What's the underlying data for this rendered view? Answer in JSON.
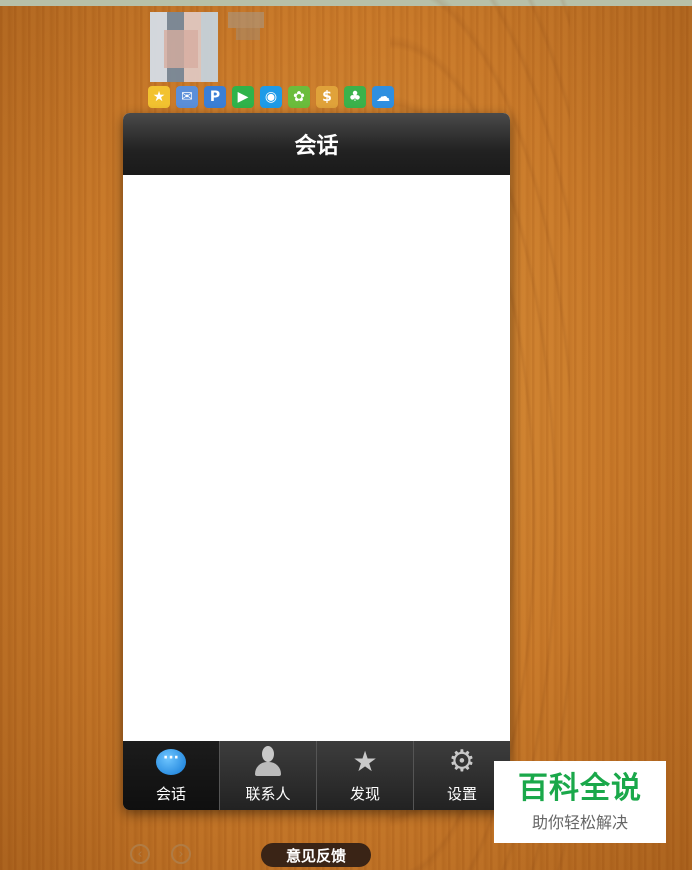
{
  "window": {
    "title": "会话"
  },
  "profile": {
    "icons": [
      {
        "name": "qzone-star-icon",
        "glyph": "★",
        "color": "#f2c230"
      },
      {
        "name": "mail-icon",
        "glyph": "✉",
        "color": "#5b8fd9"
      },
      {
        "name": "search-icon",
        "glyph": "P",
        "color": "#3a7fd6"
      },
      {
        "name": "video-play-icon",
        "glyph": "▶",
        "color": "#2fb34a"
      },
      {
        "name": "browser-icon",
        "glyph": "◉",
        "color": "#1e9be8"
      },
      {
        "name": "pet-icon",
        "glyph": "✿",
        "color": "#6bbd3c"
      },
      {
        "name": "wallet-icon",
        "glyph": "$",
        "color": "#e0a23a"
      },
      {
        "name": "clover-icon",
        "glyph": "♣",
        "color": "#3bb24b"
      },
      {
        "name": "cloud-icon",
        "glyph": "☁",
        "color": "#2f8fe0"
      }
    ]
  },
  "tabs": [
    {
      "label": "会话",
      "icon": "chat-bubble-icon"
    },
    {
      "label": "联系人",
      "icon": "contacts-icon"
    },
    {
      "label": "发现",
      "icon": "discover-star-icon"
    },
    {
      "label": "设置",
      "icon": "settings-gear-icon"
    }
  ],
  "footer": {
    "feedback": "意见反馈",
    "prev_glyph": "‹",
    "next_glyph": "›"
  },
  "watermark": {
    "title": "百科全说",
    "subtitle": "助你轻松解决"
  }
}
